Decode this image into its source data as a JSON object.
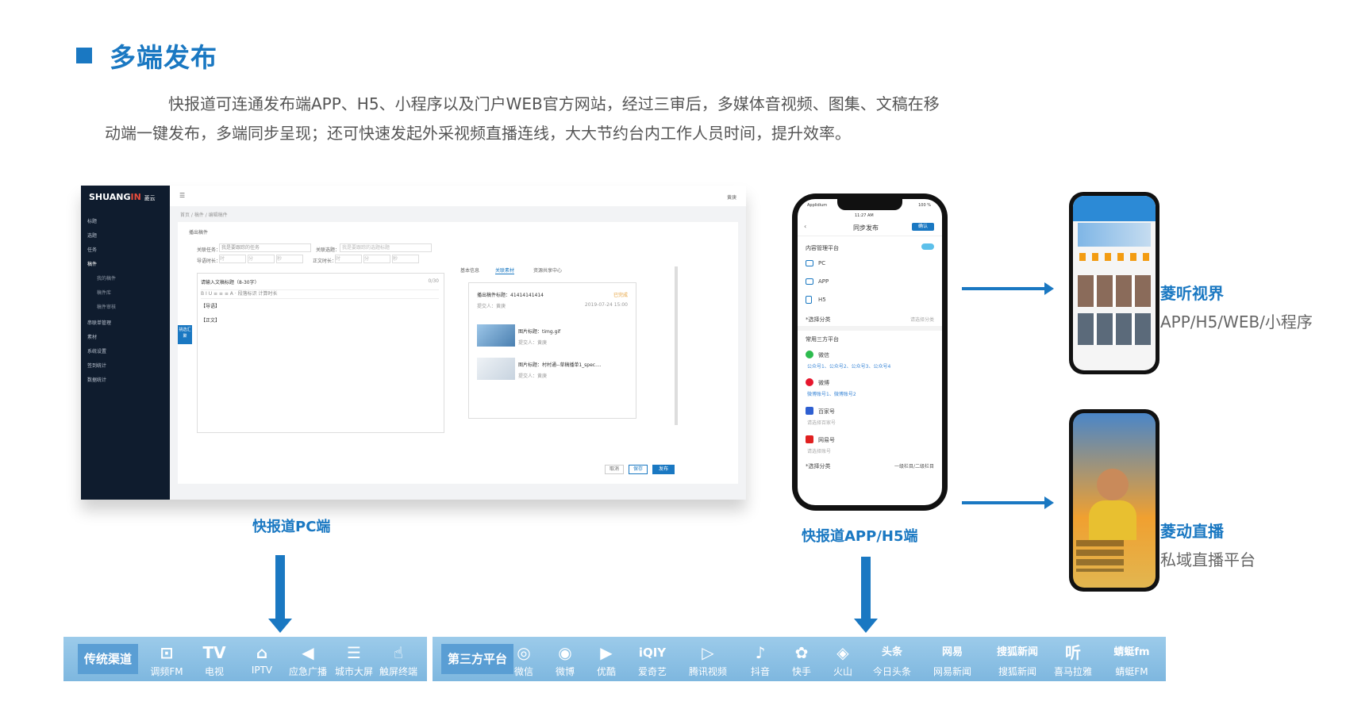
{
  "header": {
    "title": "多端发布",
    "intro_line1": "快报道可连通发布端APP、H5、小程序以及门户WEB官方网站，经过三审后，多媒体音视频、图集、文稿在移",
    "intro_line2": "动端一键发布，多端同步呈现；还可快速发起外采视频直播连线，大大节约台内工作人员时间，提升效率。"
  },
  "pc": {
    "label": "快报道PC端",
    "logo_a": "SHUANG",
    "logo_b": "IN",
    "logo_c": "菱云",
    "user": "黄庚",
    "menu": [
      "标题",
      "选题",
      "任务",
      "稿件",
      "我的稿件",
      "稿件库",
      "稿件审核",
      "串联单管理",
      "素材",
      "系统设置",
      "签到统计",
      "数据统计"
    ],
    "breadcrumb": "首页 / 稿件 / 编辑稿件",
    "card_title": "播出稿件",
    "task_label": "关联任务：",
    "task_value": "我是要跟踪的任务",
    "topic_label": "关联选题：",
    "topic_value": "我是要跟踪的选题标题",
    "leadtime_label": "导语时长：",
    "bodytime_label": "正文时长：",
    "time_unit_min": "分",
    "time_unit_sec": "秒",
    "time_unit_hr": "时",
    "editor_placeholder": "请输入文稿标题（8-30字）",
    "editor_count": "0/30",
    "editor_tools": "段落标识  计算时长",
    "lead_tag": "【导语】",
    "body_tag": "【正文】",
    "tabs": [
      "基本信息",
      "关联素材",
      "资源共享中心"
    ],
    "news_title": "播出稿件标题：41414141414",
    "news_status": "已完成",
    "news_submitter": "提交人：黄庚",
    "news_date": "2019-07-24 15:00",
    "img1_title": "图片标题：timg.gif",
    "img1_sub": "提交人：黄庚",
    "img2_title": "图片标题：村村通--草稿播单1_spec....",
    "img2_sub": "提交人：黄庚",
    "side_tag": "挑选汇聚",
    "btn_cancel": "取消",
    "btn_save": "保存",
    "btn_publish": "发布"
  },
  "app": {
    "label": "快报道APP/H5端",
    "status_left": "Applidium",
    "status_time": "11:27 AM",
    "status_right": "100 %",
    "nav_title": "同步发布",
    "nav_confirm": "确认",
    "section1": "内容管理平台",
    "rows1": [
      "PC",
      "APP",
      "H5"
    ],
    "category": "*选择分类",
    "category_hint": "请选择分类",
    "section2": "常用三方平台",
    "wechat": "微信",
    "wechat_accounts": "公众号1、公众号2、公众号3、公众号4",
    "weibo": "微博",
    "weibo_accounts": "微博账号1、微博账号2",
    "baijia": "百家号",
    "baijia_hint": "请选择百家号",
    "netease": "网易号",
    "netease_hint": "请选择账号",
    "category2": "*选择分类",
    "category2_value": "一级栏目/二级栏目"
  },
  "products": [
    {
      "name": "菱听视界",
      "sub": "APP/H5/WEB/小程序"
    },
    {
      "name": "菱动直播",
      "sub": "私域直播平台"
    }
  ],
  "channels_traditional": {
    "badge": "传统渠道",
    "items": [
      {
        "glyph": "⊡",
        "label": "调频FM"
      },
      {
        "glyph": "TV",
        "label": "电视"
      },
      {
        "glyph": "⌂",
        "label": "IPTV"
      },
      {
        "glyph": "◀",
        "label": "应急广播"
      },
      {
        "glyph": "☰",
        "label": "城市大屏"
      },
      {
        "glyph": "☝",
        "label": "触屏终端"
      }
    ]
  },
  "channels_third": {
    "badge": "第三方平台",
    "items": [
      {
        "glyph": "◎",
        "label": "微信"
      },
      {
        "glyph": "◉",
        "label": "微博"
      },
      {
        "glyph": "▶",
        "label": "优酷"
      },
      {
        "glyph": "iQIY",
        "label": "爱奇艺"
      },
      {
        "glyph": "▷",
        "label": "腾讯视频"
      },
      {
        "glyph": "♪",
        "label": "抖音"
      },
      {
        "glyph": "✿",
        "label": "快手"
      },
      {
        "glyph": "◈",
        "label": "火山"
      },
      {
        "glyph": "头条",
        "label": "今日头条"
      },
      {
        "glyph": "网易",
        "label": "网易新闻"
      },
      {
        "glyph": "搜狐新闻",
        "label": "搜狐新闻"
      },
      {
        "glyph": "听",
        "label": "喜马拉雅"
      },
      {
        "glyph": "蜻蜓fm",
        "label": "蜻蜓FM"
      }
    ]
  }
}
